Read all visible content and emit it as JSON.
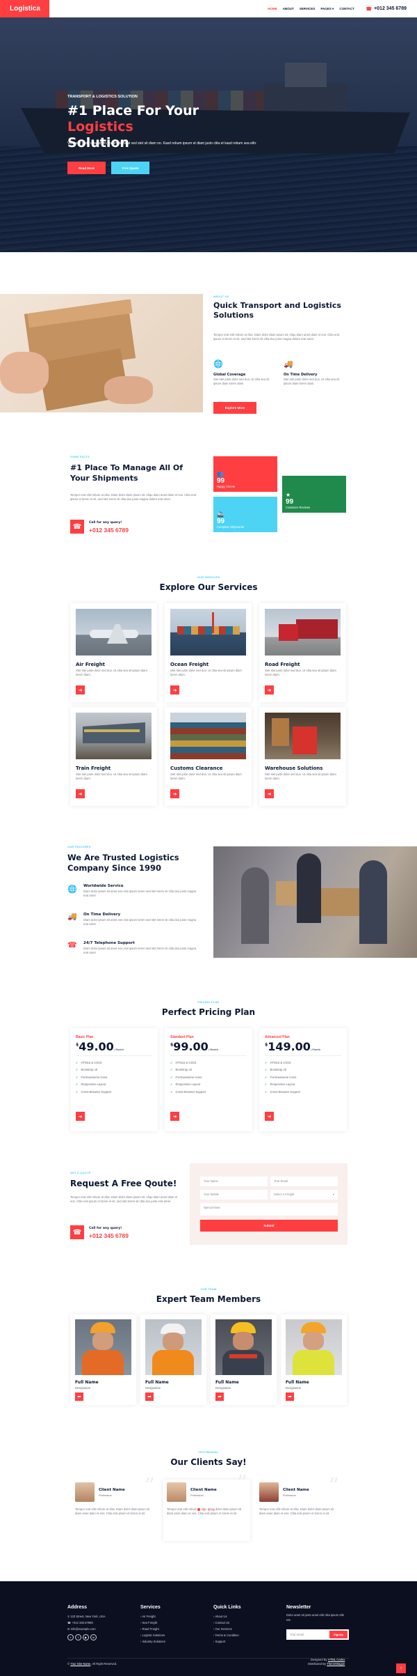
{
  "nav": {
    "brand": "Logistica",
    "menu": [
      {
        "label": "HOME"
      },
      {
        "label": "ABOUT"
      },
      {
        "label": "SERVICES"
      },
      {
        "label": "PAGES ▾"
      },
      {
        "label": "CONTACT"
      }
    ],
    "phone": "+012 345 6789"
  },
  "hero": {
    "subtitle": "TRANSPORT & LOGISTICS SOLUTION",
    "title_1": "#1 Place For Your ",
    "title_highlight": "Logistics",
    "title_2": "Solution",
    "desc": "Vero elitr justo clita lorem. Ipsum dolor at sed stet sit diam no. Kasd rebum ipsum et diam justo clita et kasd rebum sea elitr.",
    "btn_read": "Read More",
    "btn_quote": "Free Quote"
  },
  "about": {
    "sub": "ABOUT US",
    "title": "Quick Transport and Logistics Solutions",
    "desc": "Tempor erat elitr rebum at clita. Diam dolor diam ipsum sit. Aliqu diam amet diam et eos. Clita erat ipsum et lorem et sit, sed stet lorem sit clita duo justo magna dolore erat amet",
    "f1_title": "Global Coverage",
    "f1_desc": "Stet stet justo dolor sed duo. Ut clita sea sit ipsum diam lorem diam.",
    "f2_title": "On Time Delivery",
    "f2_desc": "Stet stet justo dolor sed duo. Ut clita sea sit ipsum diam lorem diam.",
    "btn": "Explore More"
  },
  "facts": {
    "sub": "SOME FACTS",
    "title": "#1 Place To Manage All Of Your Shipments",
    "desc": "Tempor erat elitr rebum at clita. Diam dolor diam ipsum sit. Aliqu diam amet diam et eos. Clita erat ipsum et lorem et sit, sed stet lorem sit clita duo justo magna dolore erat amet",
    "call_label": "Call for any query!",
    "phone": "+012 345 6789",
    "stats": [
      {
        "num": "99",
        "label": "Happy Clients"
      },
      {
        "num": "99",
        "label": "Complete Shipments"
      },
      {
        "num": "99",
        "label": "Customer Reviews"
      }
    ]
  },
  "services": {
    "sub": "OUR SERVICES",
    "title": "Explore Our Services",
    "items": [
      {
        "title": "Air Freight",
        "desc": "Stet stet justo dolor sed duo. Ut clita sea sit ipsum diam lorem diam."
      },
      {
        "title": "Ocean Freight",
        "desc": "Stet stet justo dolor sed duo. Ut clita sea sit ipsum diam lorem diam."
      },
      {
        "title": "Road Freight",
        "desc": "Stet stet justo dolor sed duo. Ut clita sea sit ipsum diam lorem diam."
      },
      {
        "title": "Train Freight",
        "desc": "Stet stet justo dolor sed duo. Ut clita sea sit ipsum diam lorem diam."
      },
      {
        "title": "Customs Clearance",
        "desc": "Stet stet justo dolor sed duo. Ut clita sea sit ipsum diam lorem diam."
      },
      {
        "title": "Warehouse Solutions",
        "desc": "Stet stet justo dolor sed duo. Ut clita sea sit ipsum diam lorem diam."
      }
    ]
  },
  "features": {
    "sub": "OUR FEATURES",
    "title": "We Are Trusted Logistics Company Since 1990",
    "items": [
      {
        "title": "Worldwide Service",
        "desc": "Diam dolor ipsum sit amet eos erat ipsum lorem sed stet lorem sit clita duo justo magna erat amet"
      },
      {
        "title": "On Time Delivery",
        "desc": "Diam dolor ipsum sit amet eos erat ipsum lorem sed stet lorem sit clita duo justo magna erat amet"
      },
      {
        "title": "24/7 Telephone Support",
        "desc": "Diam dolor ipsum sit amet eos erat ipsum lorem sed stet lorem sit clita duo justo magna erat amet"
      }
    ]
  },
  "pricing": {
    "sub": "PRICING PLAN",
    "title": "Perfect Pricing Plan",
    "plans": [
      {
        "name": "Basic Plan",
        "price": "49.00",
        "per": "/ Month"
      },
      {
        "name": "Standard Plan",
        "price": "99.00",
        "per": "/ Month"
      },
      {
        "name": "Advanced Plan",
        "price": "149.00",
        "per": "/ Month"
      }
    ],
    "features": [
      "HTML5 & CSS3",
      "Bootstrap v5",
      "FontAwesome Icons",
      "Responsive Layout",
      "Cross-Browser Support"
    ],
    "currency": "$"
  },
  "quote": {
    "sub": "GET A QUOTE",
    "title": "Request A Free Qoute!",
    "desc": "Tempor erat elitr rebum at clita. Diam dolor diam ipsum sit. Aliqu diam amet diam et eos. Clita erat ipsum et lorem et sit, sed stet lorem sit clita duo justo erat amet",
    "call_label": "Call for any query!",
    "phone": "+012 345 6789",
    "name_ph": "Your Name",
    "email_ph": "Your Email",
    "mobile_ph": "Your Mobile",
    "select": "Select A Freight",
    "note_ph": "Special Note",
    "submit": "Submit"
  },
  "team": {
    "sub": "OUR TEAM",
    "title": "Expert Team Members",
    "members": [
      {
        "name": "Full Name",
        "role": "Designation"
      },
      {
        "name": "Full Name",
        "role": "Designation"
      },
      {
        "name": "Full Name",
        "role": "Designation"
      },
      {
        "name": "Full Name",
        "role": "Designation"
      }
    ]
  },
  "testimonial": {
    "sub": "TESTIMONIAL",
    "title": "Our Clients Say!",
    "items": [
      {
        "name": "Client Name",
        "prof": "Profession",
        "text": "Tempor erat elitr rebum at clita. Diam dolor diam ipsum sit diam amet diam et eos. Clita erat ipsum et lorem et sit."
      },
      {
        "name": "Client Name",
        "prof": "Profession",
        "text": "Tempor erat elitr rebum at clita. Diam dolor diam ipsum sit diam amet diam et eos. Clita erat ipsum et lorem et sit."
      },
      {
        "name": "Client Name",
        "prof": "Profession",
        "text": "Tempor erat elitr rebum at clita. Diam dolor diam ipsum sit diam amet diam et eos. Clita erat ipsum et lorem et sit."
      }
    ]
  },
  "footer": {
    "address_title": "Address",
    "address": "123 Street, New York, USA",
    "phone": "+012 345 67890",
    "email": "info@example.com",
    "services_title": "Services",
    "services": [
      "Air Freight",
      "Sea Freight",
      "Road Freight",
      "Logistic Solutions",
      "Industry Solutions"
    ],
    "links_title": "Quick Links",
    "links": [
      "About Us",
      "Contact Us",
      "Our Services",
      "Terms & Condition",
      "Support"
    ],
    "news_title": "Newsletter",
    "news_desc": "Dolor amet sit justo amet elitr clita ipsum elitr est.",
    "news_ph": "Your email",
    "news_btn": "SignUp",
    "copyright_sym": "©",
    "site_name": "Your Site Name",
    "rights": ", All Right Reserved.",
    "designed_by": "Designed By ",
    "designer": "HTML Codex",
    "distributed_by": "Distributed By ",
    "distributor": "ThemeWagon",
    "top_icon": "arrow-up-icon"
  },
  "colors": {
    "primary": "#ff3e41",
    "secondary": "#4dd4f5",
    "dark": "#0c1833",
    "green": "#28a745"
  }
}
